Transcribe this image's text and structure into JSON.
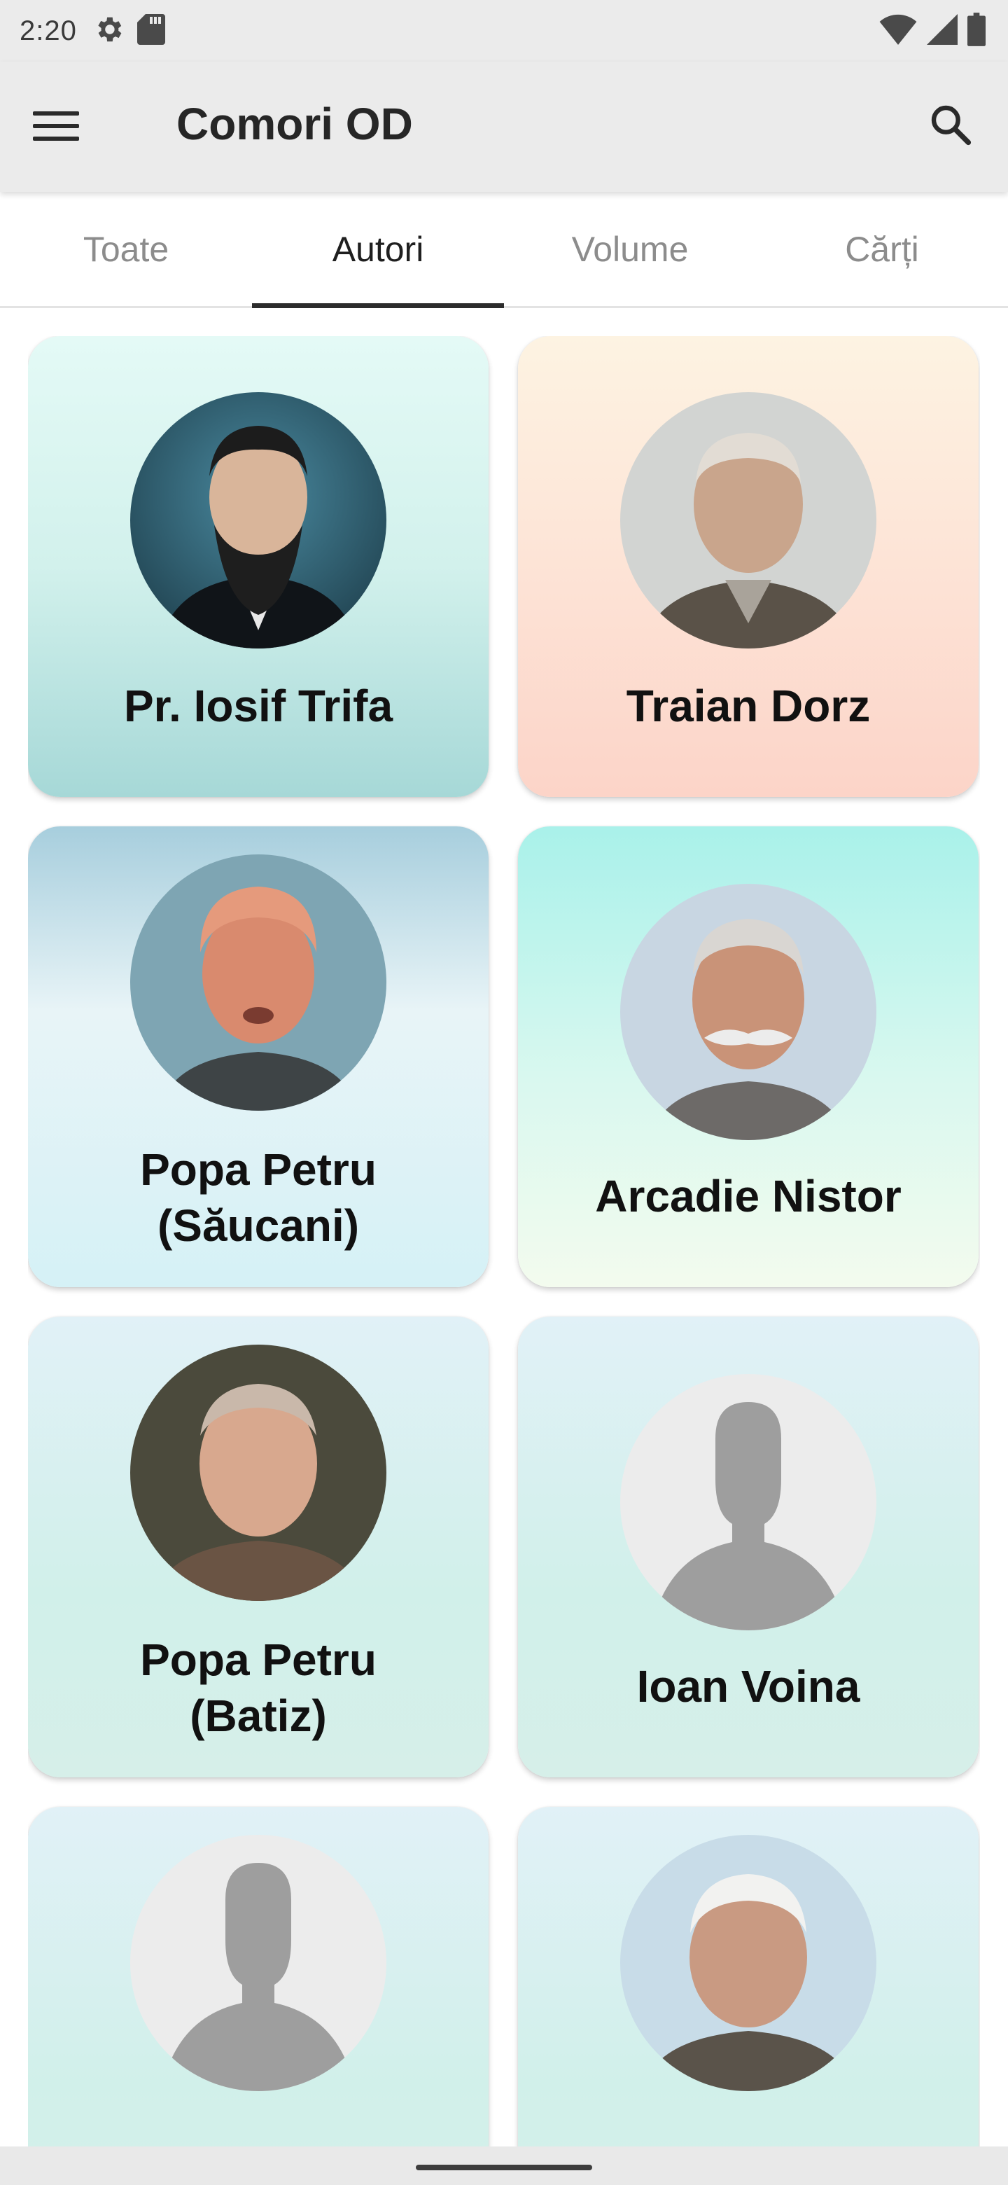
{
  "status_bar": {
    "time": "2:20",
    "left_icons": [
      "settings-gear-icon",
      "sd-card-icon"
    ],
    "right_icons": [
      "wifi-icon",
      "cellular-signal-icon",
      "battery-icon"
    ]
  },
  "app_bar": {
    "title": "Comori OD",
    "menu_icon": "hamburger-menu-icon",
    "search_icon": "search-icon"
  },
  "tabs": [
    {
      "label": "Toate",
      "active": false
    },
    {
      "label": "Autori",
      "active": true
    },
    {
      "label": "Volume",
      "active": false
    },
    {
      "label": "Cărți",
      "active": false
    }
  ],
  "authors": [
    {
      "name": "Pr. Iosif Trifa",
      "photo": "portrait-photo"
    },
    {
      "name": "Traian Dorz",
      "photo": "portrait-photo"
    },
    {
      "name_line1": "Popa Petru",
      "name_line2": "(Săucani)",
      "photo": "portrait-photo"
    },
    {
      "name": "Arcadie Nistor",
      "photo": "portrait-photo"
    },
    {
      "name_line1": "Popa Petru",
      "name_line2": "(Batiz)",
      "photo": "portrait-photo"
    },
    {
      "name": "Ioan Voina",
      "photo": "placeholder-silhouette"
    },
    {
      "photo": "placeholder-silhouette"
    },
    {
      "photo": "portrait-photo"
    }
  ],
  "colors": {
    "app_bar_bg": "#ebebeb",
    "tab_active": "#1f1f1f",
    "tab_inactive": "#8c8c8c",
    "silhouette": "#9e9e9e",
    "silhouette_bg": "#ececec"
  }
}
